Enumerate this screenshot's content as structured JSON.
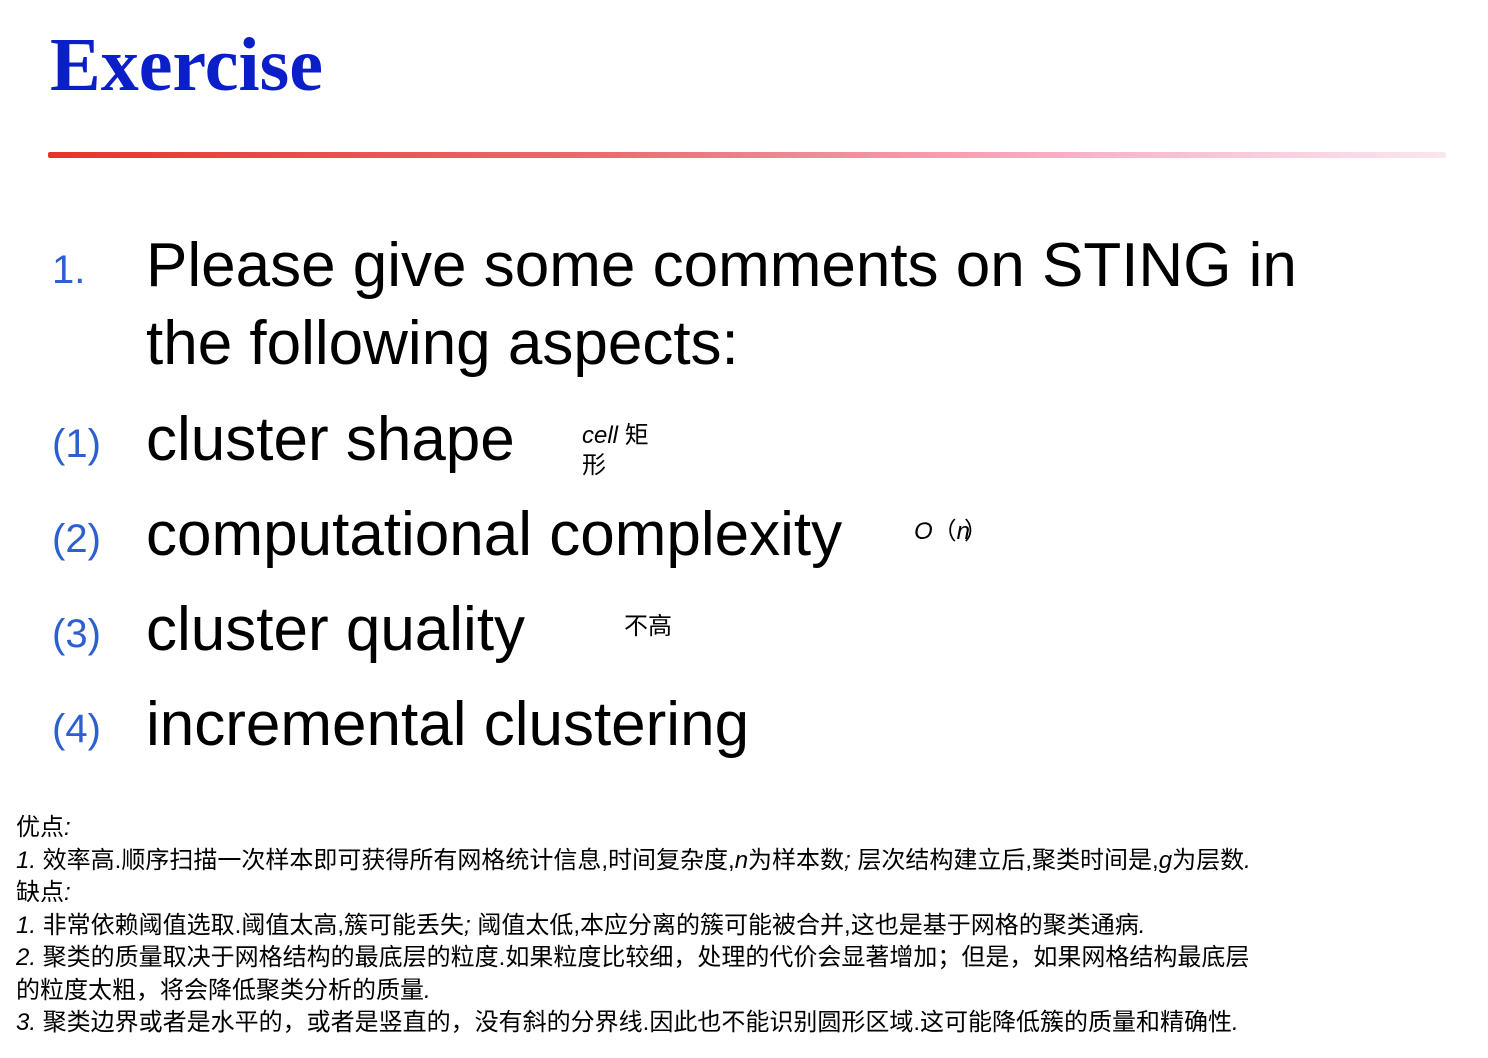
{
  "title": "Exercise",
  "question": {
    "number": "1.",
    "line1": "Please give some comments on STING in",
    "line2": "the following aspects:"
  },
  "aspects": [
    {
      "num": "(1)",
      "text": "cluster shape"
    },
    {
      "num": "(2)",
      "text": "computational complexity"
    },
    {
      "num": "(3)",
      "text": "cluster quality"
    },
    {
      "num": "(4)",
      "text": "incremental clustering"
    }
  ],
  "notes": {
    "shape_italic": "cell",
    "shape_line1": "矩",
    "shape_line2": "形",
    "complexity_o": "O",
    "complexity_paren_open": "（",
    "complexity_n": "n",
    "complexity_paren_close": "）",
    "quality": "不高"
  },
  "bottom": {
    "pros_title": "优点",
    "pros_colon": ":",
    "pros1_num": "1.",
    "pros1_text_a": " 效率高.顺序扫描一次样本即可获得所有网格统计信息,时间复杂度,",
    "pros1_n": "n",
    "pros1_text_b": "为样本数",
    "pros1_semicolon": ";",
    "pros1_text_c": " 层次结构建立后,聚类时间是,",
    "pros1_g": "g",
    "pros1_text_d": "为层数",
    "pros1_period": ".",
    "cons_title": "缺点",
    "cons_colon": ":",
    "cons1_num": "1.",
    "cons1_text_a": " 非常依赖阈值选取.阈值太高,簇可能丢失",
    "cons1_semicolon": ";",
    "cons1_text_b": " 阈值太低,本应分离的簇可能被合并,这也是基于网格的聚类通病",
    "cons1_period": ".",
    "cons2_num": "2.",
    "cons2_text_a": " 聚类的质量取决于网格结构的最底层的粒度.如果粒度比较细，处理的代价会显著增加；但是，如果网格结构最底层",
    "cons2_text_b": "的粒度太粗，将会降低聚类分析的质量",
    "cons2_period": ".",
    "cons3_num": "3.",
    "cons3_text": " 聚类边界或者是水平的，或者是竖直的，没有斜的分界线.因此也不能识别圆形区域.这可能降低簇的质量和精确性",
    "cons3_period": "."
  }
}
